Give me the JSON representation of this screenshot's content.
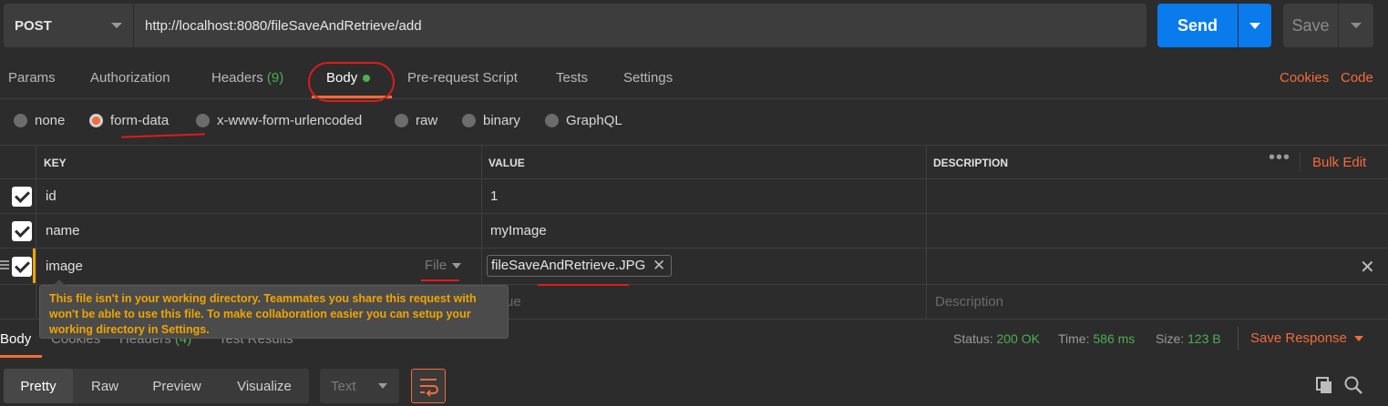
{
  "request": {
    "method": "POST",
    "url": "http://localhost:8080/fileSaveAndRetrieve/add",
    "send_label": "Send",
    "save_label": "Save"
  },
  "tabs": [
    {
      "label": "Params"
    },
    {
      "label": "Authorization"
    },
    {
      "label": "Headers",
      "count": "(9)"
    },
    {
      "label": "Body"
    },
    {
      "label": "Pre-request Script"
    },
    {
      "label": "Tests"
    },
    {
      "label": "Settings"
    }
  ],
  "tabs_right": {
    "cookies": "Cookies",
    "code": "Code"
  },
  "body_types": [
    "none",
    "form-data",
    "x-www-form-urlencoded",
    "raw",
    "binary",
    "GraphQL"
  ],
  "selected_body_type": "form-data",
  "table": {
    "headers": {
      "key": "KEY",
      "value": "VALUE",
      "description": "DESCRIPTION"
    },
    "bulk_edit": "Bulk Edit",
    "rows": [
      {
        "key": "id",
        "value": "1",
        "checked": true
      },
      {
        "key": "name",
        "value": "myImage",
        "checked": true
      },
      {
        "key": "image",
        "type": "File",
        "value": "fileSaveAndRetrieve.JPG",
        "checked": true
      }
    ],
    "new_row": {
      "value_placeholder": "ue",
      "description_placeholder": "Description"
    }
  },
  "tooltip": {
    "line1": "This file isn't in your working directory. Teammates you share this request with",
    "line2": "won't be able to use this file. To make collaboration easier you can setup your",
    "line3": "working directory in Settings."
  },
  "response": {
    "tabs": [
      "Body",
      "Cookies",
      "Headers",
      "Test Results"
    ],
    "headers_count": "(4)",
    "status_label": "Status:",
    "status_value": "200 OK",
    "time_label": "Time:",
    "time_value": "586 ms",
    "size_label": "Size:",
    "size_value": "123 B",
    "save_response": "Save Response"
  },
  "view": {
    "modes": [
      "Pretty",
      "Raw",
      "Preview",
      "Visualize"
    ],
    "active_mode": "Pretty",
    "format": "Text"
  },
  "icons": {
    "wrap": "wrap-lines-icon",
    "copy": "copy-icon",
    "search": "search-icon"
  },
  "colors": {
    "accent": "#f26b3a",
    "send": "#097bed",
    "success": "#4caf50",
    "warning": "#f0a500",
    "annotation": "#e01b1b"
  }
}
